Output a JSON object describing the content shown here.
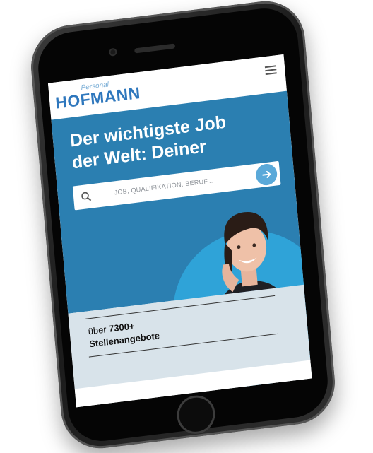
{
  "header": {
    "logo_top": "Personal",
    "logo_main": "HOFMANN"
  },
  "hero": {
    "headline_line1": "Der wichtigste Job",
    "headline_line2": "der Welt: Deiner",
    "search_placeholder": "JOB, QUALIFIKATION, BERUF..."
  },
  "stats": {
    "prefix": "über ",
    "count": "7300+",
    "label": "Stellenangebote"
  },
  "colors": {
    "brand_blue": "#2e77bd",
    "hero_blue": "#2b7fb1",
    "accent_circle": "#2fa3d8",
    "search_button": "#5aa9d9",
    "lower_panel": "#d8e3ea"
  },
  "icons": [
    "menu-icon",
    "search-icon",
    "arrow-right-icon"
  ]
}
